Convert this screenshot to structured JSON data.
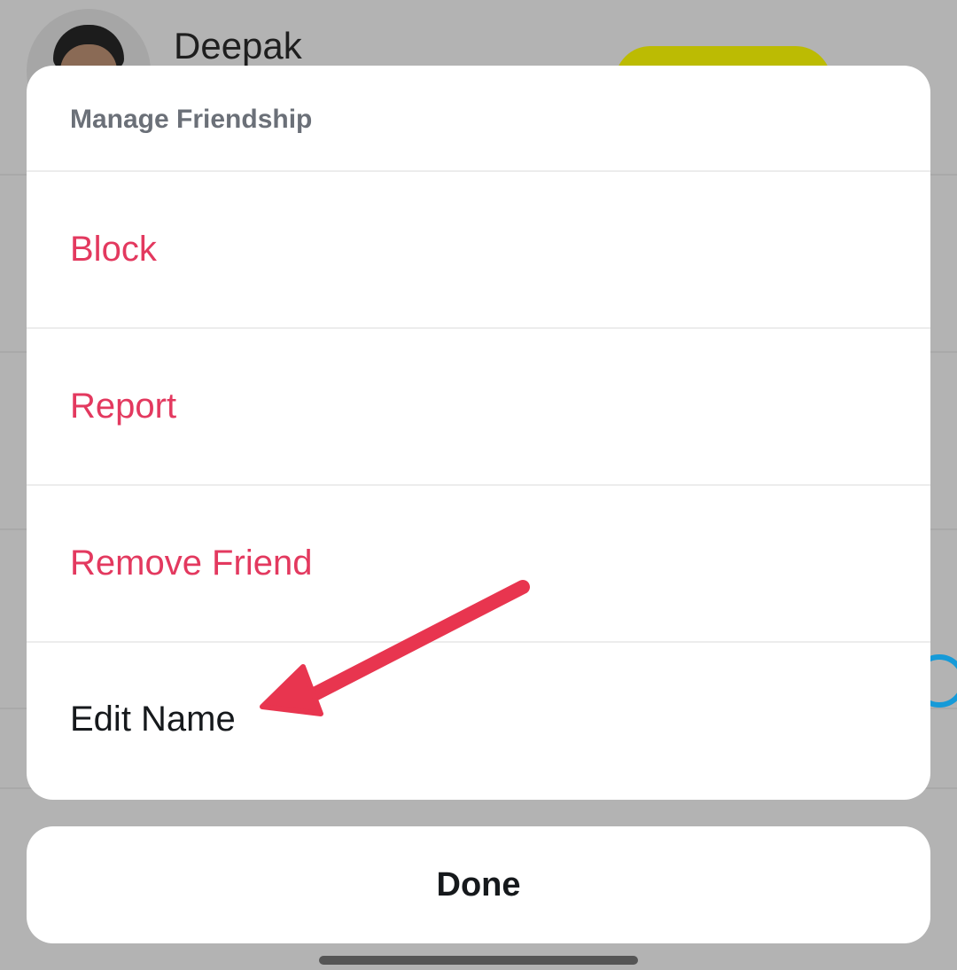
{
  "background": {
    "profile_name": "Deepak"
  },
  "sheet": {
    "title": "Manage Friendship",
    "items": [
      {
        "label": "Block",
        "style": "danger"
      },
      {
        "label": "Report",
        "style": "danger"
      },
      {
        "label": "Remove Friend",
        "style": "danger"
      },
      {
        "label": "Edit Name",
        "style": "normal"
      }
    ]
  },
  "done_button": {
    "label": "Done"
  },
  "colors": {
    "danger": "#e3395f",
    "annotation_arrow": "#e8354f",
    "overlay": "#b3b3b3",
    "accent_pill": "#bcbb03"
  },
  "annotation": {
    "icon": "red-arrow-icon",
    "points_to": "Edit Name"
  }
}
